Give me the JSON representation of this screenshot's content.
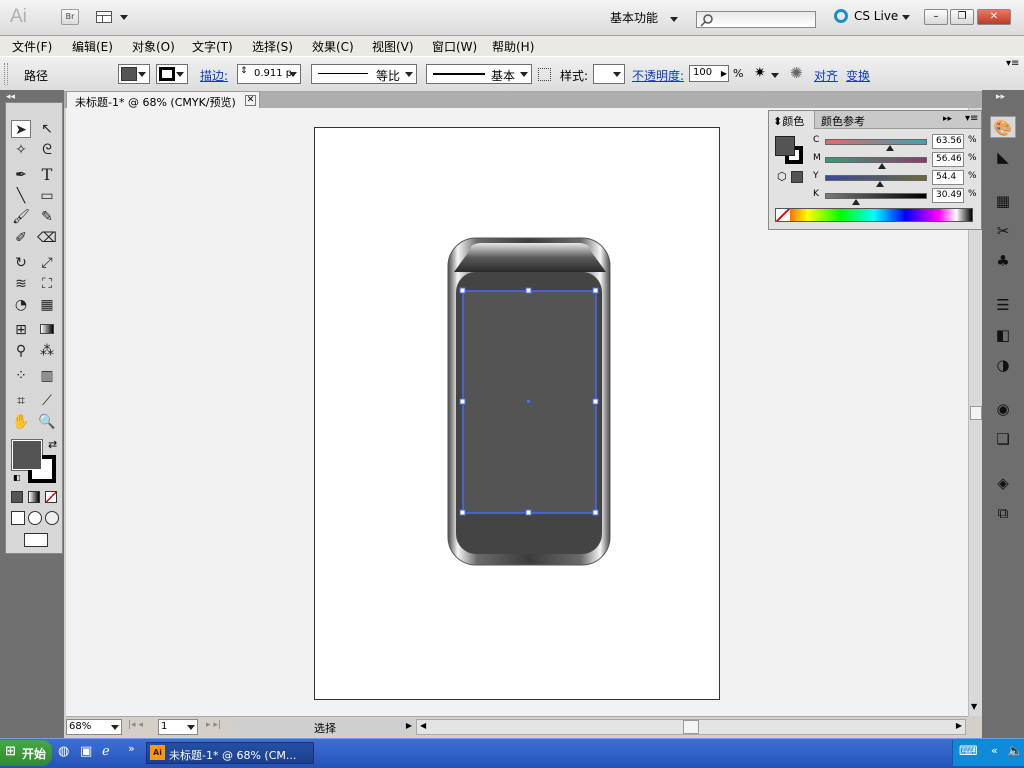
{
  "app": {
    "logo": "Ai",
    "bridge": "Br",
    "workspace": "基本功能",
    "cs_live": "CS Live",
    "window_controls": {
      "minimize": "–",
      "restore": "❐",
      "close": "✕"
    }
  },
  "menu": [
    "文件(F)",
    "编辑(E)",
    "对象(O)",
    "文字(T)",
    "选择(S)",
    "效果(C)",
    "视图(V)",
    "窗口(W)",
    "帮助(H)"
  ],
  "control_bar": {
    "selection_type": "路径",
    "stroke_label": "描边:",
    "stroke_weight": "0.911 p",
    "profile_label": "等比",
    "brush_label": "基本",
    "style_label": "样式:",
    "opacity_label": "不透明度:",
    "opacity_value": "100",
    "opacity_unit": "%",
    "align_label": "对齐",
    "transform_label": "变换"
  },
  "document": {
    "tab_title": "未标题-1* @ 68% (CMYK/预览)"
  },
  "color_panel": {
    "tab_color": "颜色",
    "tab_guide": "颜色参考",
    "channels": [
      {
        "label": "C",
        "value": "63.56",
        "unit": "%",
        "level": 0.64,
        "color": "#c94c4c"
      },
      {
        "label": "M",
        "value": "56.46",
        "unit": "%",
        "level": 0.56,
        "color": "#4c9c7c"
      },
      {
        "label": "Y",
        "value": "54.4",
        "unit": "%",
        "level": 0.54,
        "color": "#4a5fa0"
      },
      {
        "label": "K",
        "value": "30.49",
        "unit": "%",
        "level": 0.3,
        "color": "#555555"
      }
    ],
    "fill_color": "#545454"
  },
  "status_bar": {
    "zoom": "68%",
    "page": "1",
    "status_text": "选择"
  },
  "taskbar": {
    "start_label": "开始",
    "task_item": "未标题-1* @ 68% (CM..."
  }
}
